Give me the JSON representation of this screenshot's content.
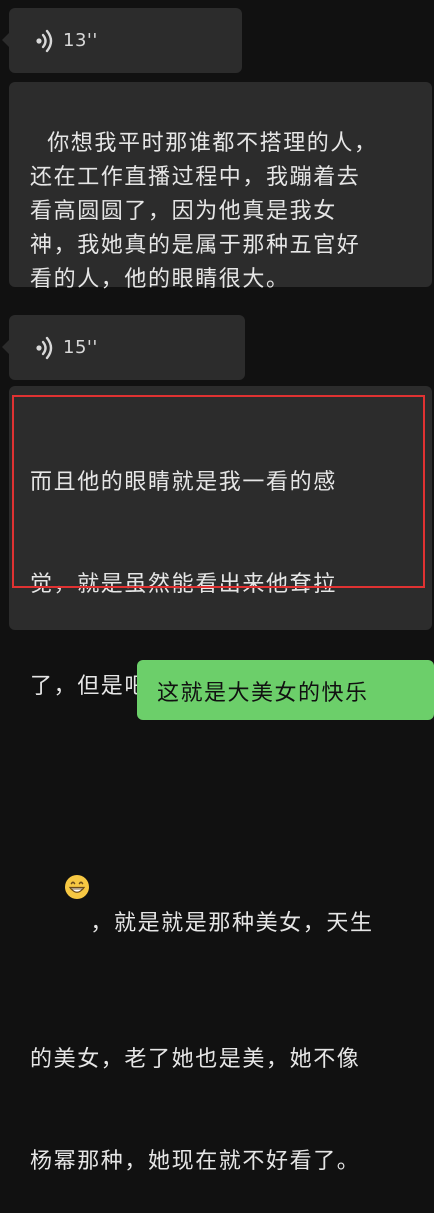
{
  "messages": [
    {
      "type": "voice",
      "duration": "13''"
    },
    {
      "type": "text",
      "text": "你想我平时那谁都不搭理的人，\n还在工作直播过程中，我蹦着去\n看高圆圆了，因为他真是我女\n神，我她真的是属于那种五官好\n看的人，他的眼睛很大。"
    },
    {
      "type": "voice",
      "duration": "15''"
    },
    {
      "type": "text",
      "line1": "而且他的眼睛就是我一看的感",
      "line2": "觉，就是虽然能看出来他耷拉",
      "line3": "了，但是吧，就是美就是美",
      "line4_after_emoji": "，就是就是那种美女，天生",
      "line5": "的美女，老了她也是美，她不像",
      "line6": "杨幂那种，她现在就不好看了。",
      "emoji": "grinning-face-emoji"
    },
    {
      "type": "text_self",
      "text": "这就是大美女的快乐"
    }
  ],
  "icons": {
    "voice": "voice-wave-icon"
  },
  "colors": {
    "background": "#111111",
    "bubble_received": "#2c2c2c",
    "bubble_sent": "#6ccf6a",
    "highlight": "#e03232"
  }
}
